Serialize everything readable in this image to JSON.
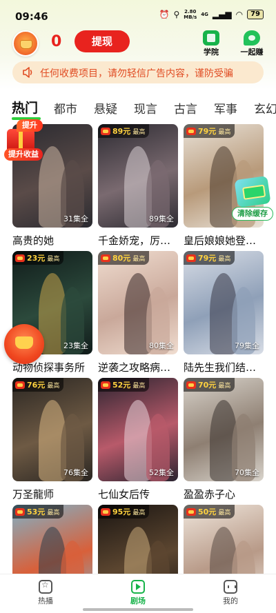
{
  "status_bar": {
    "time": "09:46",
    "net_speed_value": "2.80",
    "net_speed_unit": "MB/s",
    "network": "4G",
    "battery": "79"
  },
  "header": {
    "coin_count": "0",
    "withdraw_label": "提现",
    "tools": [
      {
        "label": "学院",
        "icon": "academy-icon"
      },
      {
        "label": "一起赚",
        "icon": "earn-together-icon"
      }
    ]
  },
  "notice": {
    "text": "任何收费项目，请勿轻信广告内容，谨防受骗"
  },
  "tabs": [
    {
      "label": "热门",
      "active": true
    },
    {
      "label": "都市"
    },
    {
      "label": "悬疑"
    },
    {
      "label": "现言"
    },
    {
      "label": "古言"
    },
    {
      "label": "军事"
    },
    {
      "label": "玄幻"
    }
  ],
  "floating": {
    "boost_top": "提升",
    "boost_label": "提升收益",
    "clear_cache": "清除缓存"
  },
  "badge_suffix": "最高",
  "dramas": [
    {
      "title": "高贵的她",
      "episodes": "31集全",
      "reward": null,
      "palette": [
        "#2a2a30",
        "#5a4b48",
        "#c9b3a0"
      ]
    },
    {
      "title": "千金娇宠，厉先生夜夜...",
      "episodes": "89集全",
      "reward": "89元",
      "palette": [
        "#2d2b32",
        "#7a6a70",
        "#d9cfd4"
      ]
    },
    {
      "title": "皇后娘娘她登基了",
      "episodes": "",
      "reward": "79元",
      "palette": [
        "#e9e2d8",
        "#b89a7a",
        "#4a3a2e"
      ]
    },
    {
      "title": "动物侦探事务所",
      "episodes": "23集全",
      "reward": "23元",
      "palette": [
        "#101b1a",
        "#2c4a3c",
        "#c7a24a"
      ]
    },
    {
      "title": "逆袭之攻略病娇大佬",
      "episodes": "80集全",
      "reward": "80元",
      "palette": [
        "#f0ddd0",
        "#c9a89a",
        "#3a2a2a"
      ]
    },
    {
      "title": "陆先生我们结婚吧",
      "episodes": "79集全",
      "reward": "79元",
      "palette": [
        "#d8dde6",
        "#8fa0b8",
        "#3a3a48"
      ]
    },
    {
      "title": "万圣龍师",
      "episodes": "76集全",
      "reward": "76元",
      "palette": [
        "#2a2622",
        "#6e5a44",
        "#d7b482"
      ]
    },
    {
      "title": "七仙女后传",
      "episodes": "52集全",
      "reward": "52元",
      "palette": [
        "#2b2430",
        "#b85a6a",
        "#e8d2d8"
      ]
    },
    {
      "title": "盈盈赤子心",
      "episodes": "70集全",
      "reward": "70元",
      "palette": [
        "#d9d4cc",
        "#8e7f72",
        "#3c3432"
      ]
    },
    {
      "title": "",
      "episodes": "",
      "reward": "53元",
      "palette": [
        "#7fb2c8",
        "#d8603a",
        "#2c3c48"
      ]
    },
    {
      "title": "",
      "episodes": "",
      "reward": "95元",
      "palette": [
        "#1a1512",
        "#5c4630",
        "#c9a97a"
      ]
    },
    {
      "title": "",
      "episodes": "",
      "reward": "50元",
      "palette": [
        "#efe6dc",
        "#b89a88",
        "#5a4a44"
      ]
    }
  ],
  "bottom_nav": [
    {
      "label": "热播",
      "active": false
    },
    {
      "label": "剧场",
      "active": true
    },
    {
      "label": "我的",
      "active": false
    }
  ],
  "colors": {
    "accent_green": "#17b34a",
    "withdraw_red": "#e8231e",
    "notice_bg": "#fbe9cf",
    "notice_text": "#e04b22",
    "badge_gold": "#ffd23f"
  }
}
